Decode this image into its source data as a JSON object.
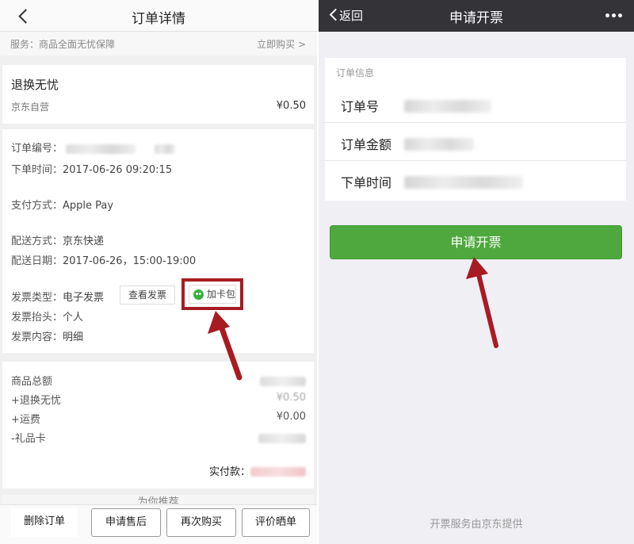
{
  "left": {
    "nav": {
      "title": "订单详情"
    },
    "service": {
      "label": "服务：商品全面无忧保障",
      "action": "立即购买 >"
    },
    "product": {
      "name": "退换无忧",
      "shop": "京东自营",
      "price": "¥0.50"
    },
    "order": {
      "order_no_label": "订单编号：",
      "order_time_label": "下单时间：",
      "order_time": "2017-06-26 09:20:15",
      "pay_label": "支付方式：",
      "pay_value": "Apple Pay",
      "ship_label": "配送方式：",
      "ship_value": "京东快递",
      "ship_date_label": "配送日期：",
      "ship_date_value": "2017-06-26，15:00-19:00",
      "invoice_type_label": "发票类型：",
      "invoice_type_value": "电子发票",
      "view_invoice": "查看发票",
      "add_wallet": "加卡包",
      "invoice_title_label": "发票抬头：",
      "invoice_title_value": "个人",
      "invoice_content_label": "发票内容：",
      "invoice_content_value": "明细"
    },
    "summary": {
      "total_label": "商品总额",
      "return_label": "+退换无忧",
      "return_value": "¥0.50",
      "shipping_label": "+运费",
      "shipping_value": "¥0.00",
      "giftcard_label": "-礼品卡",
      "paid_label": "实付款："
    },
    "recommend": "为你推荐",
    "footer": {
      "delete": "删除订单",
      "after_sale": "申请售后",
      "rebuy": "再次购买",
      "review": "评价晒单"
    }
  },
  "right": {
    "nav": {
      "back": "返回",
      "title": "申请开票",
      "more": "•••"
    },
    "section_label": "订单信息",
    "rows": [
      {
        "label": "订单号"
      },
      {
        "label": "订单金额"
      },
      {
        "label": "下单时间"
      }
    ],
    "apply_button": "申请开票",
    "footer_text": "开票服务由京东提供"
  },
  "colors": {
    "highlight_red": "#a71c22",
    "wechat_green": "#4fa83d",
    "dark_nav": "#333338"
  }
}
